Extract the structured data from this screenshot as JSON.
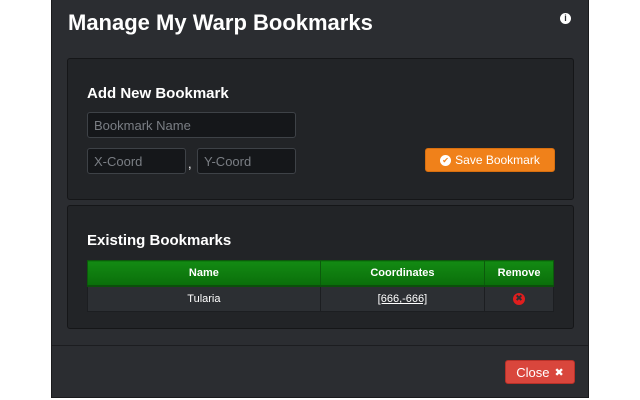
{
  "modal": {
    "title": "Manage My Warp Bookmarks",
    "info_icon": "info-icon",
    "info_glyph": "i"
  },
  "add_section": {
    "heading": "Add New Bookmark",
    "name_field": {
      "value": "",
      "placeholder": "Bookmark Name"
    },
    "x_field": {
      "value": "",
      "placeholder": "X-Coord"
    },
    "separator": ",",
    "y_field": {
      "value": "",
      "placeholder": "Y-Coord"
    },
    "save_button": {
      "label": "Save Bookmark",
      "icon": "check-circle-icon",
      "icon_glyph": "✔",
      "color": "#f0811a"
    }
  },
  "existing_section": {
    "heading": "Existing Bookmarks",
    "table": {
      "header_color": "#0f7d0f",
      "columns": [
        "Name",
        "Coordinates",
        "Remove"
      ],
      "rows": [
        {
          "name": "Tularia",
          "coordinates": "[666,-666]",
          "remove_icon": "remove-circle-icon",
          "remove_glyph": "✖"
        }
      ]
    }
  },
  "footer": {
    "close_button": {
      "label": "Close",
      "icon": "close-x-icon",
      "icon_glyph": "✖",
      "color": "#d9463c"
    }
  }
}
